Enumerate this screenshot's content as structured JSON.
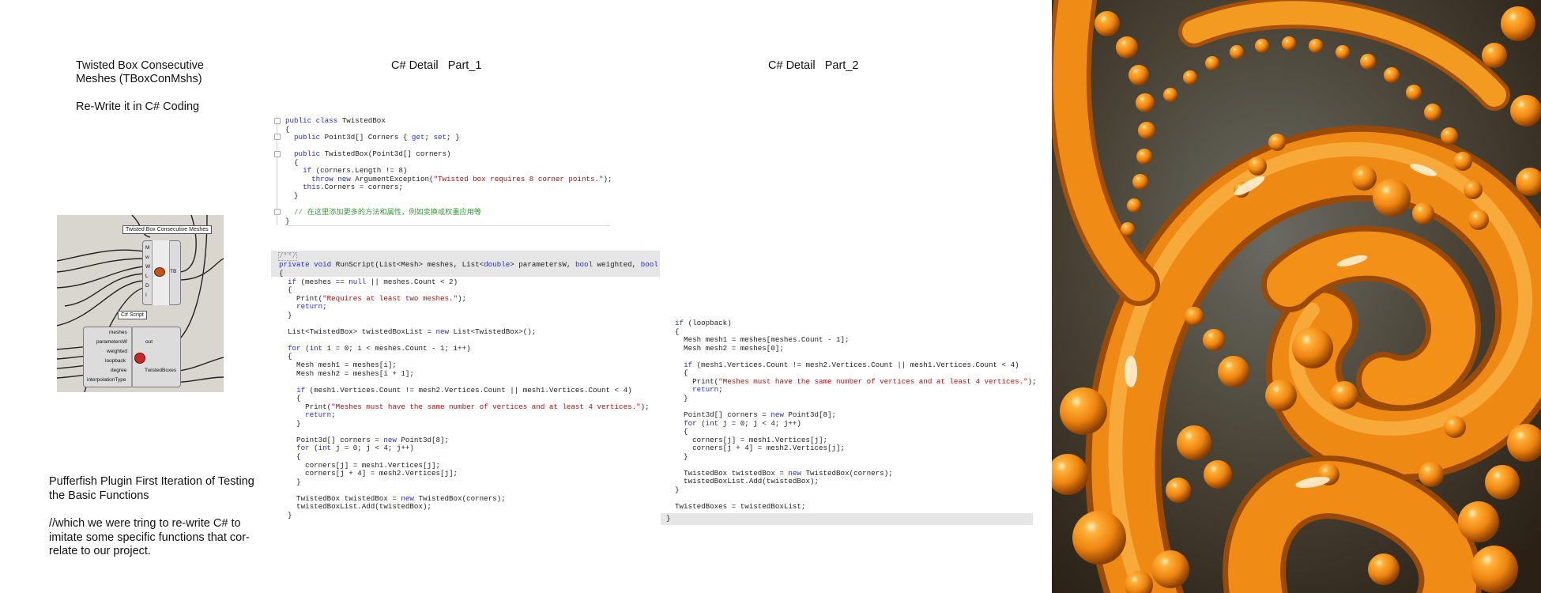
{
  "left_panel": {
    "title": "Twisted Box Consecutive\nMeshes (TBoxConMshs)",
    "subtitle": "Re-Write it in C# Coding",
    "bottom_heading": "Pufferfish Plugin First Iteration of Testing\nthe Basic Functions",
    "bottom_note": "//which we were tring to re-write C# to\nimitate some specific functions that cor-\nrelate to our project."
  },
  "grasshopper": {
    "component_title": "Twisted Box Consecutive Meshes",
    "component_inputs": [
      "M",
      "w",
      "W",
      "L",
      "D",
      "I"
    ],
    "component_output": "TB",
    "script_title": "C# Script",
    "script_inputs": [
      "meshes",
      "parametersW",
      "weighted",
      "loopback",
      "degree",
      "interpolationType"
    ],
    "script_outputs": [
      "out",
      "TwistedBoxes"
    ]
  },
  "headings": {
    "part1": "C# Detail   Part_1",
    "part2": "C# Detail   Part_2"
  },
  "code": {
    "class_block": "public class TwistedBox\n{\n  public Point3d[] Corners { get; set; }\n\n  public TwistedBox(Point3d[] corners)\n  {\n    if (corners.Length != 8)\n      throw new ArgumentException(\"Twisted box requires 8 corner points.\");\n    this.Corners = corners;\n  }\n\n  // 在这里添加更多的方法和属性，例如变换或权重应用等\n}",
    "summary_stub": "/**/",
    "signature": "private void RunScript(List<Mesh> meshes, List<double> parametersW, bool weighted, bool loo",
    "part1_body": "{\n  if (meshes == null || meshes.Count < 2)\n  {\n    Print(\"Requires at least two meshes.\");\n    return;\n  }\n\n  List<TwistedBox> twistedBoxList = new List<TwistedBox>();\n\n  for (int i = 0; i < meshes.Count - 1; i++)\n  {\n    Mesh mesh1 = meshes[i];\n    Mesh mesh2 = meshes[i + 1];\n\n    if (mesh1.Vertices.Count != mesh2.Vertices.Count || mesh1.Vertices.Count < 4)\n    {\n      Print(\"Meshes must have the same number of vertices and at least 4 vertices.\");\n      return;\n    }\n\n    Point3d[] corners = new Point3d[8];\n    for (int j = 0; j < 4; j++)\n    {\n      corners[j] = mesh1.Vertices[j];\n      corners[j + 4] = mesh2.Vertices[j];\n    }\n\n    TwistedBox twistedBox = new TwistedBox(corners);\n    twistedBoxList.Add(twistedBox);\n  }",
    "part2_body": "  if (loopback)\n  {\n    Mesh mesh1 = meshes[meshes.Count - 1];\n    Mesh mesh2 = meshes[0];\n\n    if (mesh1.Vertices.Count != mesh2.Vertices.Count || mesh1.Vertices.Count < 4)\n    {\n      Print(\"Meshes must have the same number of vertices and at least 4 vertices.\");\n      return;\n    }\n\n    Point3d[] corners = new Point3d[8];\n    for (int j = 0; j < 4; j++)\n    {\n      corners[j] = mesh1.Vertices[j];\n      corners[j + 4] = mesh2.Vertices[j];\n    }\n\n    TwistedBox twistedBox = new TwistedBox(corners);\n    twistedBoxList.Add(twistedBox);\n  }\n\n  TwistedBoxes = twistedBoxList;",
    "closing_brace": "}"
  },
  "colors": {
    "keyword": "#2b2bd0",
    "string": "#a31515",
    "comment": "#3c9a3c",
    "code_highlight_band": "#e6e6e6",
    "grasshopper_canvas": "#d8d6cf",
    "art_orange": "#f08a12"
  },
  "image": {
    "subject": "orange-bubble-sculpture"
  }
}
